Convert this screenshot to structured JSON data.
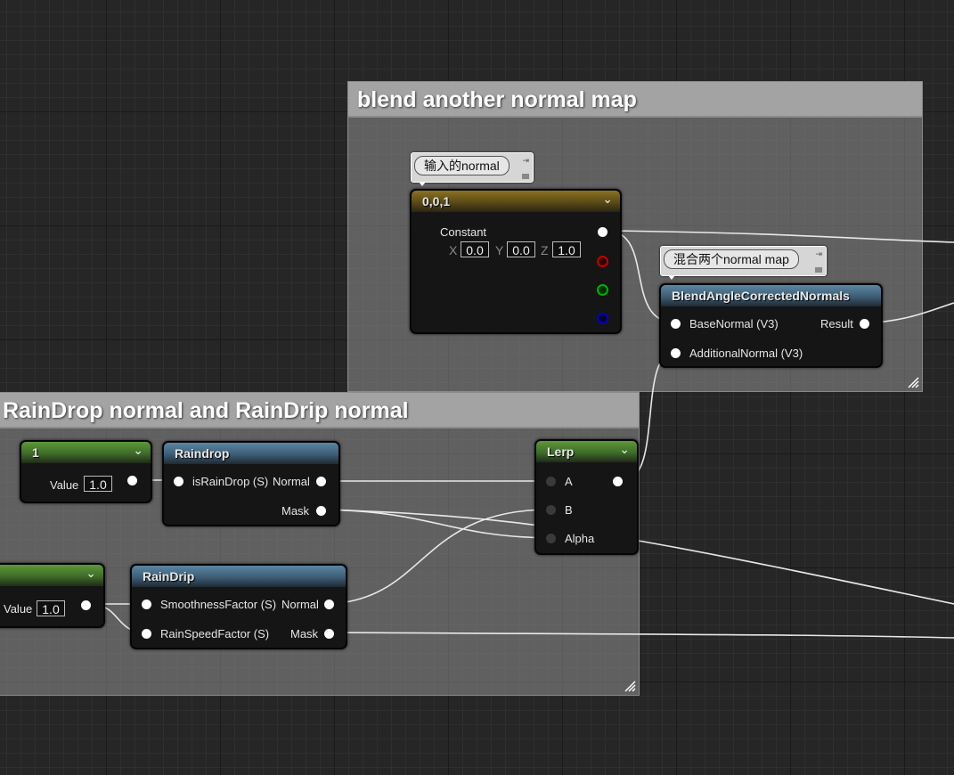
{
  "comments": {
    "blend": {
      "title": "blend another normal map"
    },
    "rain": {
      "title": "RainDrop normal and RainDrip normal"
    }
  },
  "bubbles": {
    "input_normal": "输入的normal",
    "blend_two": "混合两个normal map"
  },
  "nodes": {
    "const3": {
      "title": "0,0,1",
      "label": "Constant",
      "x_label": "X",
      "x_value": "0.0",
      "y_label": "Y",
      "y_value": "0.0",
      "z_label": "Z",
      "z_value": "1.0"
    },
    "blend_angle": {
      "title": "BlendAngleCorrectedNormals",
      "in1": "BaseNormal (V3)",
      "in2": "AdditionalNormal (V3)",
      "out": "Result"
    },
    "const1_top": {
      "title": "1",
      "value_label": "Value",
      "value": "1.0"
    },
    "raindrop": {
      "title": "Raindrop",
      "in1": "isRainDrop (S)",
      "out1": "Normal",
      "out2": "Mask"
    },
    "lerp": {
      "title": "Lerp",
      "in_a": "A",
      "in_b": "B",
      "in_alpha": "Alpha"
    },
    "const1_bottom": {
      "value_label": "Value",
      "value": "1.0"
    },
    "raindrip": {
      "title": "RainDrip",
      "in1": "SmoothnessFactor (S)",
      "in2": "RainSpeedFactor (S)",
      "out1": "Normal",
      "out2": "Mask"
    }
  },
  "colors": {
    "header_constant3": "#8a7222",
    "header_function": "#5b86a4",
    "header_constant": "#5d9839",
    "pin_red": "#c00000",
    "pin_green": "#00b000",
    "pin_blue": "#0000c8",
    "wire": "#e8e8e8"
  }
}
